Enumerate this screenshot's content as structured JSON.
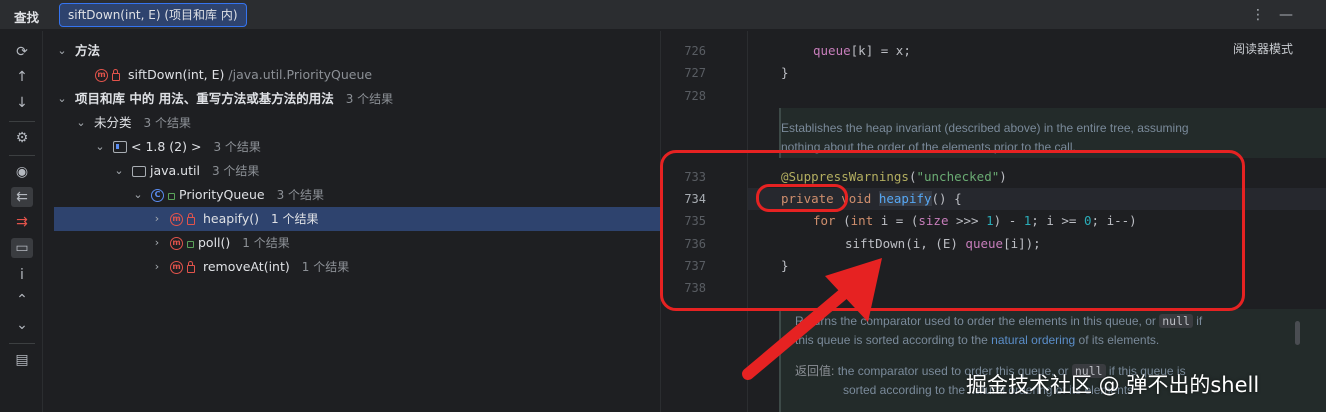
{
  "header": {
    "toolwindow_title": "查找",
    "tab_label": "siftDown(int, E) (项目和库 内)",
    "more_icon": "⋮",
    "minimize_icon": "—"
  },
  "left_toolbar": {
    "icons": [
      "rerun-icon",
      "up-arrow-icon",
      "down-arrow-icon",
      "settings-icon",
      "preview-icon",
      "import-icon",
      "export-icon",
      "group-folder-icon",
      "info-icon",
      "expand-all-icon",
      "collapse-all-icon",
      "layout-icon"
    ],
    "info_label": "i"
  },
  "tree": {
    "methods_header": "方法",
    "target_method": "siftDown(int, E)",
    "target_path": "/java.util.PriorityQueue",
    "usages_header": "项目和库 中的 用法、重写方法或基方法的用法",
    "usages_count": "3 个结果",
    "uncategorized": "未分类",
    "uncategorized_count": "3 个结果",
    "jdk": "< 1.8 (2) >",
    "jdk_count": "3 个结果",
    "package": "java.util",
    "package_count": "3 个结果",
    "class": "PriorityQueue",
    "class_count": "3 个结果",
    "items": [
      {
        "label": "heapify()",
        "count": "1 个结果"
      },
      {
        "label": "poll()",
        "count": "1 个结果"
      },
      {
        "label": "removeAt(int)",
        "count": "1 个结果"
      }
    ]
  },
  "editor": {
    "reader_mode": "阅读器模式",
    "line_numbers": [
      "726",
      "727",
      "728",
      "733",
      "734",
      "735",
      "736",
      "737",
      "738"
    ],
    "code": {
      "l726_a": "queue",
      "l726_b": "[k] = x;",
      "l727": "}",
      "ann": "@SuppressWarnings",
      "ann_open": "(",
      "ann_str": "\"unchecked\"",
      "ann_close": ")",
      "kw_private": "private",
      "kw_void": " void ",
      "fn_heapify": "heapify",
      "sig_rest": "() {",
      "kw_for": "for",
      "for_a": " (",
      "kw_int": "int",
      "for_b": " i = (",
      "fld_size": "size",
      "for_c": " >>> ",
      "n1": "1",
      "for_d": ") - ",
      "n2": "1",
      "for_e": "; i >= ",
      "n0": "0",
      "for_f": "; i--)",
      "sift_a": "siftDown(i, (E) ",
      "fld_queue": "queue",
      "sift_b": "[i]);",
      "close1": "}"
    },
    "doc1_line1": "Establishes the heap invariant (described above) in the entire tree, assuming",
    "doc1_line2": "nothing about the order of the elements prior to the call.",
    "doc2_line1_a": "Returns the comparator used to order the elements in this queue, or",
    "doc2_null": "null",
    "doc2_line1_b": "if",
    "doc2_line2_a": "this queue is sorted according to the",
    "doc2_link": "natural ordering",
    "doc2_line2_b": "of its elements.",
    "return_label": "返回值:",
    "return_a": "the comparator used to order this queue, or",
    "return_null": "null",
    "return_b": "if this queue is",
    "return_line2": "sorted according to the natural ordering of its elements"
  },
  "watermark": "掘金技术社区 @ 弹不出的shell",
  "colors": {
    "annotation_red": "#e62222",
    "selection": "#2e436e",
    "keyword": "#cf8e6d",
    "function": "#56a8f5"
  }
}
